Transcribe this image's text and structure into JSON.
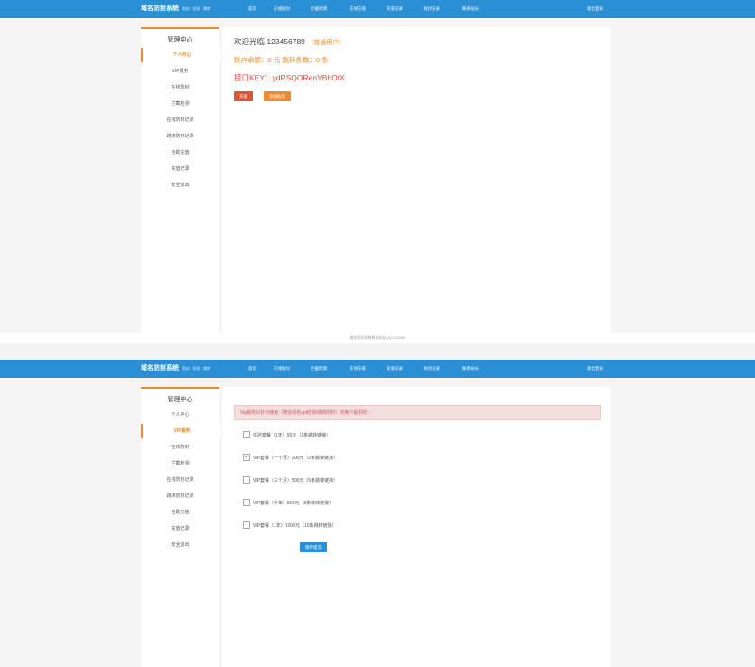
{
  "brand": {
    "title": "域名防封系统",
    "subtitle": "防封 · 检测 · 跳转"
  },
  "nav": [
    "首页",
    "在线防封",
    "拦截检测",
    "在线充值",
    "充值记录",
    "防封记录",
    "联系站长"
  ],
  "logout": "退出登录",
  "sidebar": {
    "title": "管理中心",
    "items": [
      "个人中心",
      "VIP服务",
      "在线防封",
      "拦截检测",
      "在线防封记录",
      "跳转防封记录",
      "自助充值",
      "充值记录",
      "安全退出"
    ]
  },
  "profile": {
    "welcome": "欢迎光临 123456789",
    "user_type": "（普通用户）",
    "balance": "账户余额：0 元    跳转条数：0 条",
    "apikey": "接口KEY：ydRSQORenYBhOtX",
    "recharge_button": "充值",
    "add_button": "添加防封"
  },
  "footer": "域名防封系统联系站长QQ:123456",
  "vip": {
    "notice": "Vip服务只针对使用（微信域名api检测/跳转防封）的用户提供的~",
    "options": [
      {
        "label": "体验套餐（1天）50元（1条跳转链接）",
        "checked": false
      },
      {
        "label": "VIP套餐（一个月）200元（2条跳转链接）",
        "checked": true
      },
      {
        "label": "VIP套餐（三个月）500元（5条跳转链接）",
        "checked": false
      },
      {
        "label": "VIP套餐（半年）800元（8条跳转链接）",
        "checked": false
      },
      {
        "label": "VIP套餐（1年）1000元（10条跳转链接）",
        "checked": false
      }
    ],
    "submit": "保存提交"
  },
  "colors": {
    "nav": "#2b8fd6",
    "accent": "#f08a2b",
    "danger": "#e0533a"
  }
}
